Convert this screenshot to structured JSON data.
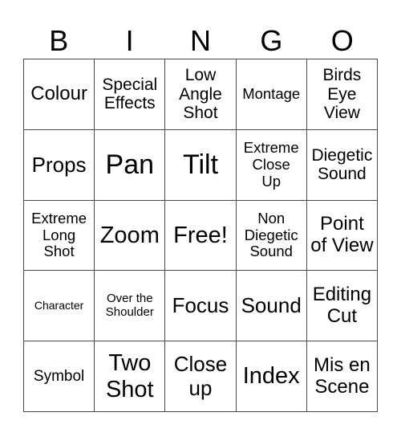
{
  "card": {
    "header": [
      "B",
      "I",
      "N",
      "G",
      "O"
    ],
    "rows": [
      [
        "Colour",
        "Special\nEffects",
        "Low\nAngle\nShot",
        "Montage",
        "Birds\nEye\nView"
      ],
      [
        "Props",
        "Pan",
        "Tilt",
        "Extreme\nClose\nUp",
        "Diegetic\nSound"
      ],
      [
        "Extreme\nLong\nShot",
        "Zoom",
        "Free!",
        "Non\nDiegetic\nSound",
        "Point\nof View"
      ],
      [
        "Character",
        "Over the\nShoulder",
        "Focus",
        "Sound",
        "Editing\nCut"
      ],
      [
        "Symbol",
        "Two\nShot",
        "Close\nup",
        "Index",
        "Mis en\nScene"
      ]
    ]
  }
}
